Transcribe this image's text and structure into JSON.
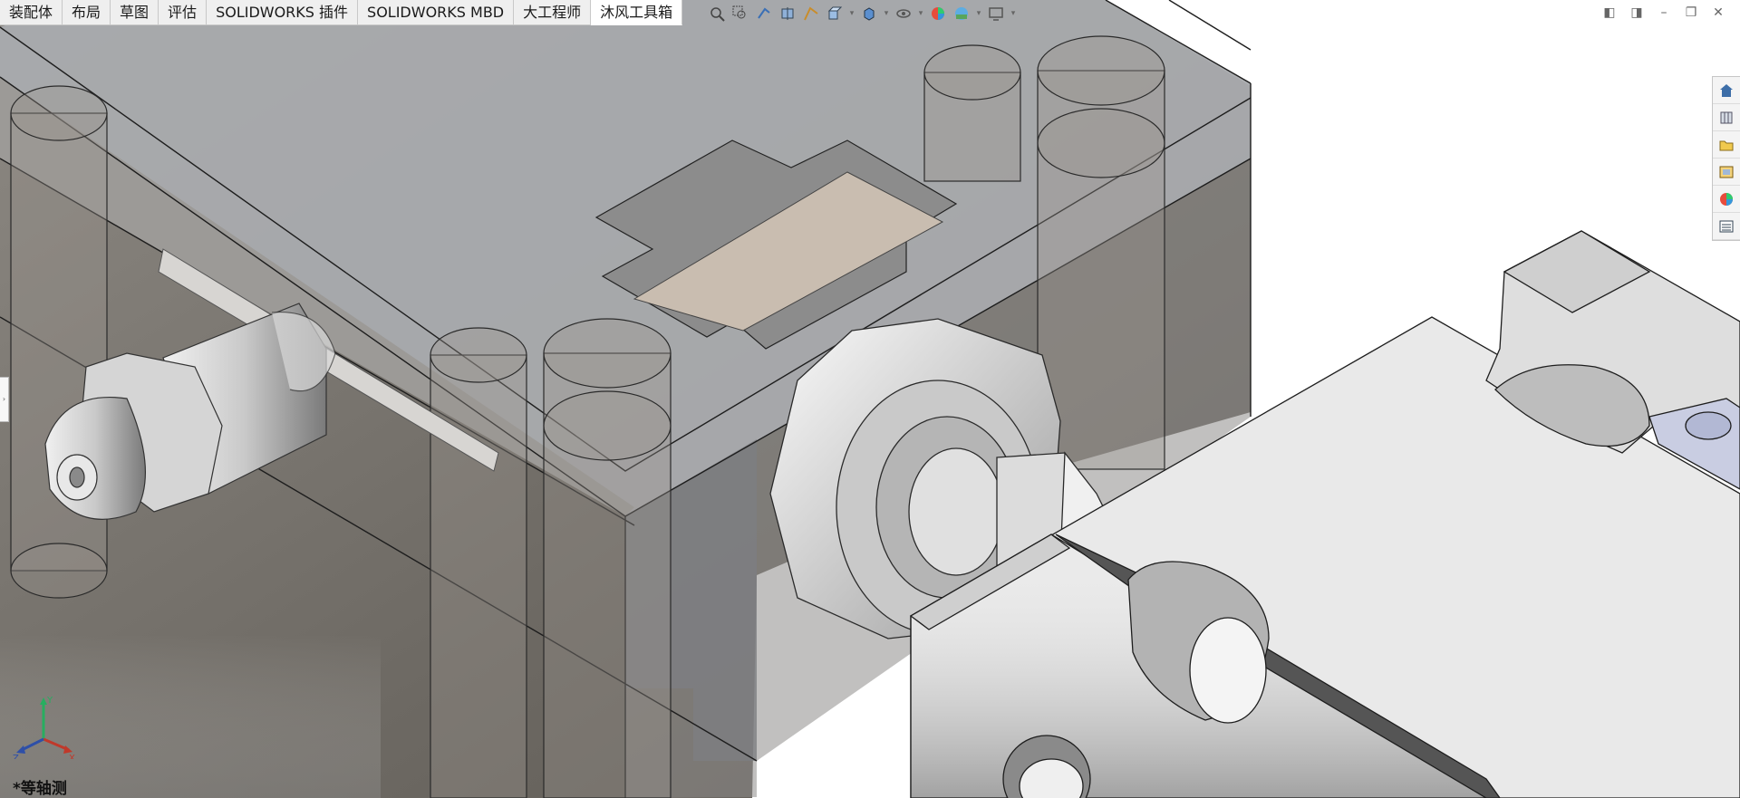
{
  "tabs": [
    {
      "label": "装配体",
      "active": false
    },
    {
      "label": "布局",
      "active": false
    },
    {
      "label": "草图",
      "active": false
    },
    {
      "label": "评估",
      "active": false
    },
    {
      "label": "SOLIDWORKS 插件",
      "active": false
    },
    {
      "label": "SOLIDWORKS MBD",
      "active": false
    },
    {
      "label": "大工程师",
      "active": false
    },
    {
      "label": "沐风工具箱",
      "active": true
    }
  ],
  "hud_icons": [
    "zoom-to-fit-icon",
    "zoom-to-area-icon",
    "previous-view-icon",
    "section-view-icon",
    "dynamic-annotation-icon",
    "view-orientation-icon",
    "display-style-icon",
    "hide-show-items-icon",
    "edit-appearance-icon",
    "apply-scene-icon",
    "view-settings-icon"
  ],
  "task_pane_icons": [
    "solidworks-resources-icon",
    "design-library-icon",
    "file-explorer-icon",
    "view-palette-icon",
    "appearances-icon",
    "custom-properties-icon"
  ],
  "view": {
    "name": "*等轴测",
    "triad": {
      "x": "X",
      "y": "Y",
      "z": "Z"
    }
  },
  "colors": {
    "tab_bg": "#efefef",
    "tab_active_bg": "#ffffff",
    "viewport_bg": "#ffffff",
    "transparent_block": "#8f8a82",
    "triad_x": "#c0392b",
    "triad_y": "#27ae60",
    "triad_z": "#2e4fa8"
  }
}
